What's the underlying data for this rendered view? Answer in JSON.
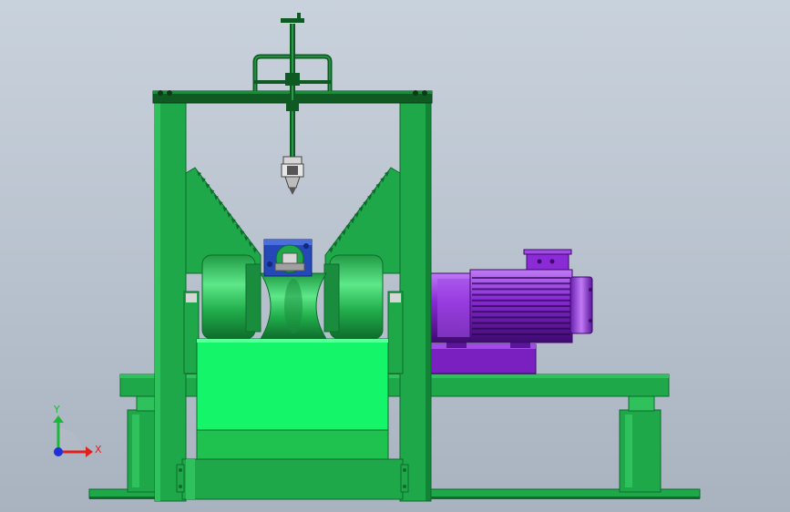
{
  "view": {
    "background_top": "#c9d2dc",
    "background_bottom": "#a9b3c0"
  },
  "colors": {
    "frame_green": "#1fa84a",
    "frame_dark": "#0e6b2b",
    "frame_light": "#2fc25c",
    "bright_green": "#14f56a",
    "roller_green": "#25c24f",
    "top_bar": "#0f5a22",
    "motor_purple": "#8a2bd6",
    "motor_dark": "#4a0f80",
    "motor_light": "#b25cf0",
    "gearbox_blue": "#2448b8",
    "gearbox_dark": "#12287a",
    "silver": "#d6d6d6"
  },
  "triad": {
    "y_label": "Y",
    "x_label": "X",
    "y_color": "#1db83a",
    "x_color": "#e0201f",
    "z_color": "#2030d8"
  }
}
